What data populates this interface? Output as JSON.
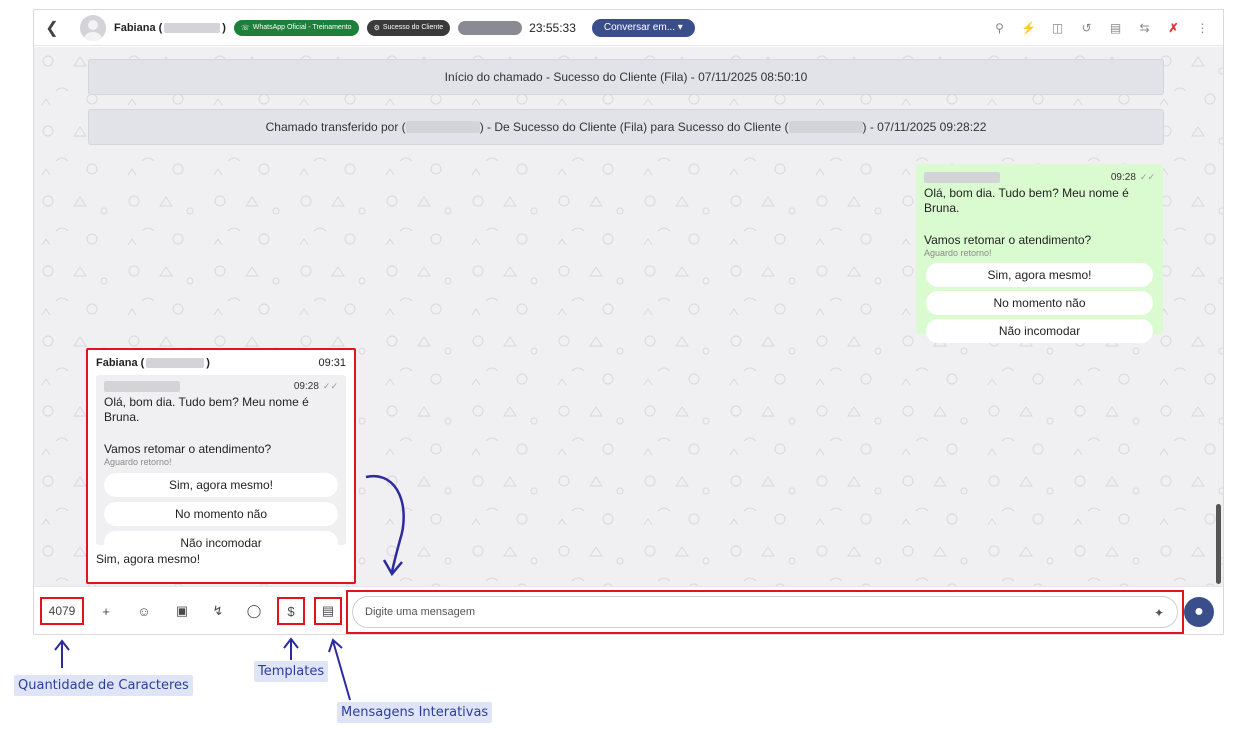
{
  "header": {
    "contact_name": "Fabiana (",
    "contact_name_close": ")",
    "whatsapp_tag": "WhatsApp Oficial - Treinamento",
    "queue_tag": "Sucesso do Cliente",
    "timer": "23:55:33",
    "converse_button": "Conversar em... ▾"
  },
  "header_icons": [
    "search-icon",
    "plug-icon",
    "columns-icon",
    "history-icon",
    "calendar-icon",
    "transfer-icon",
    "end-call-icon",
    "more-icon"
  ],
  "system_messages": [
    "Início do chamado - Sucesso do Cliente (Fila) - 07/11/2025 08:50:10",
    "Chamado transferido por (",
    ") - De Sucesso do Cliente (Fila) para Sucesso do Cliente (",
    ") - 07/11/2025 09:28:22"
  ],
  "outgoing": {
    "time": "09:28",
    "ticks": "✓✓",
    "line1": "Olá, bom dia. Tudo bem? Meu nome é Bruna.",
    "line2": "Vamos retomar o atendimento?",
    "footer": "Aguardo retorno!",
    "options": [
      "Sim, agora mesmo!",
      "No momento não",
      "Não incomodar"
    ]
  },
  "incoming": {
    "name": "Fabiana (",
    "name_close": ")",
    "time": "09:31",
    "quote_time": "09:28",
    "quote_ticks": "✓✓",
    "quote_line1": "Olá, bom dia. Tudo bem? Meu nome é Bruna.",
    "quote_line2": "Vamos retomar o atendimento?",
    "quote_footer": "Aguardo retorno!",
    "quote_options": [
      "Sim, agora mesmo!",
      "No momento não",
      "Não incomodar"
    ],
    "reply": "Sim, agora mesmo!"
  },
  "footer": {
    "char_count": "4079",
    "input_placeholder": "Digite uma mensagem",
    "icons": [
      "plus-icon",
      "emoji-icon",
      "sticker-icon",
      "quick-reply-icon",
      "chat-bubble-icon",
      "templates-icon",
      "interactive-messages-icon",
      "magic-wand-icon",
      "microphone-icon"
    ]
  },
  "annotations": {
    "char_count_label": "Quantidade de Caracteres",
    "templates_label": "Templates",
    "interactive_label": "Mensagens Interativas"
  },
  "colors": {
    "accent": "#3a4e8c",
    "outgoing_bubble": "#d9fbcf",
    "highlight": "#e0131f",
    "annotation_bg": "#dfe5f6",
    "annotation_text": "#2c3e9a"
  }
}
